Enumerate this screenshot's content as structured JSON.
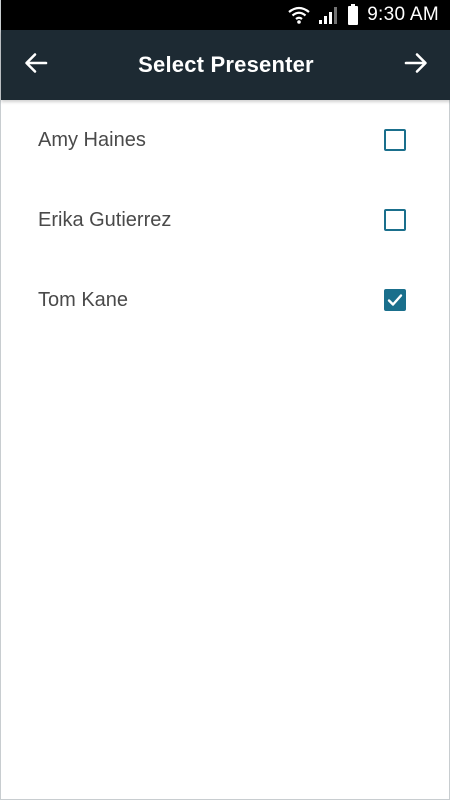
{
  "status_bar": {
    "time": "9:30 AM",
    "icons": [
      "wifi-icon",
      "signal-icon",
      "battery-icon"
    ]
  },
  "app_bar": {
    "title": "Select Presenter",
    "back_icon": "arrow-left-icon",
    "next_icon": "arrow-right-icon",
    "background_color": "#1d2a33"
  },
  "presenters": [
    {
      "name": "Amy Haines",
      "checked": false
    },
    {
      "name": "Erika Gutierrez",
      "checked": false
    },
    {
      "name": "Tom Kane",
      "checked": true
    }
  ],
  "colors": {
    "accent": "#1a6f8c",
    "text": "#4a4a4a"
  }
}
